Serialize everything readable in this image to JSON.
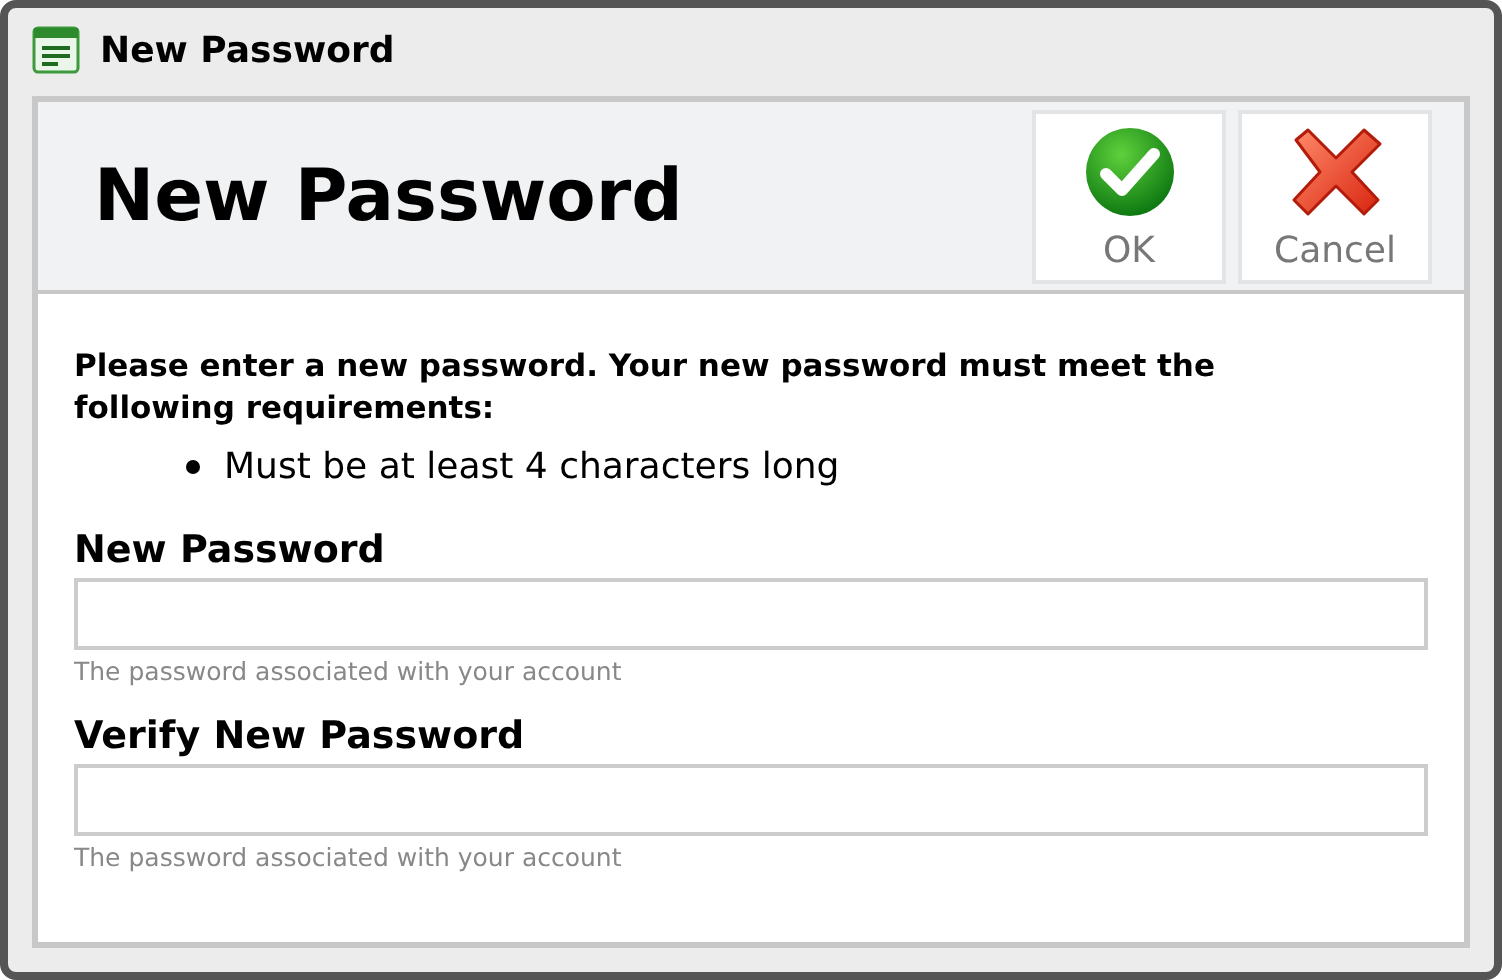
{
  "window": {
    "title": "New Password"
  },
  "header": {
    "title": "New Password",
    "buttons": [
      {
        "kind": "ok",
        "label": "OK"
      },
      {
        "kind": "cancel",
        "label": "Cancel"
      }
    ]
  },
  "instructions": "Please enter a new password. Your new password must meet the following requirements:",
  "requirements": [
    "Must be at least 4 characters long"
  ],
  "fields": [
    {
      "label": "New Password",
      "help": "The password associated with your account"
    },
    {
      "label": "Verify New Password",
      "help": "The password associated with your account"
    }
  ]
}
